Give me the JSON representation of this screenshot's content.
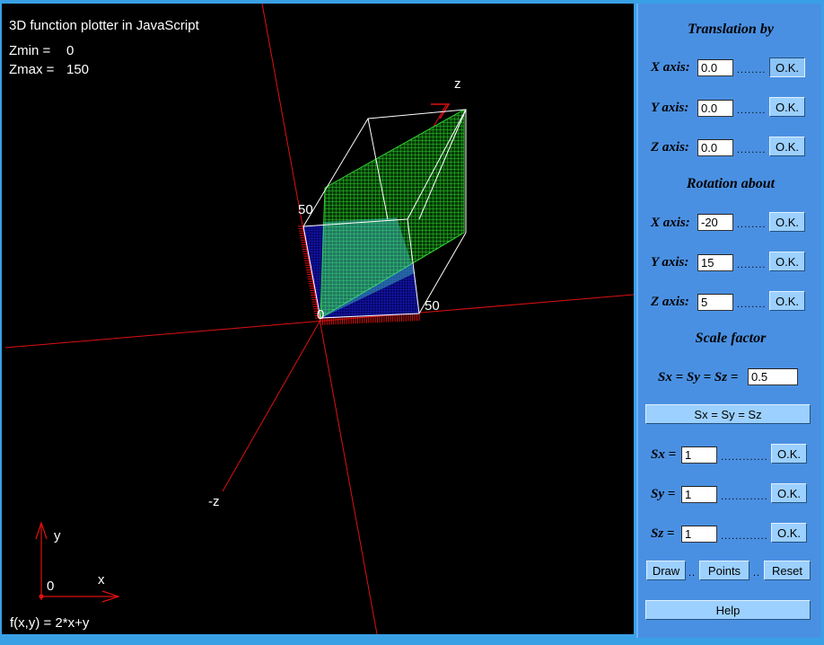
{
  "plot": {
    "title": "3D function plotter in JavaScript",
    "zmin_label": "Zmin =",
    "zmin_value": "0",
    "zmax_label": "Zmax =",
    "zmax_value": "150",
    "function_label": "f(x,y) = 2*x+y",
    "axis_z_label": "z",
    "axis_negz_label": "-z",
    "tick_50_left": "50",
    "tick_0": "0",
    "tick_50_right": "50",
    "legend_y": "y",
    "legend_x": "x",
    "legend_origin": "0",
    "colors": {
      "background": "#000000",
      "axes": "#e01010",
      "surface": "#33dd33",
      "base": "#1010b0",
      "box": "#ffffff"
    }
  },
  "panel": {
    "translation": {
      "title": "Translation by",
      "x": {
        "label": "X axis:",
        "value": "0.0",
        "button": "O.K."
      },
      "y": {
        "label": "Y axis:",
        "value": "0.0",
        "button": "O.K."
      },
      "z": {
        "label": "Z axis:",
        "value": "0.0",
        "button": "O.K."
      }
    },
    "rotation": {
      "title": "Rotation about",
      "x": {
        "label": "X axis:",
        "value": "-20",
        "button": "O.K."
      },
      "y": {
        "label": "Y axis:",
        "value": "15",
        "button": "O.K."
      },
      "z": {
        "label": "Z axis:",
        "value": "5",
        "button": "O.K."
      }
    },
    "scale": {
      "title": "Scale factor",
      "uniform_label": "Sx = Sy = Sz =",
      "uniform_value": "0.5",
      "uniform_button": "Sx = Sy = Sz",
      "sx": {
        "label": "Sx =",
        "value": "1",
        "button": "O.K."
      },
      "sy": {
        "label": "Sy =",
        "value": "1",
        "button": "O.K."
      },
      "sz": {
        "label": "Sz =",
        "value": "1",
        "button": "O.K."
      }
    },
    "actions": {
      "draw": "Draw",
      "points": "Points",
      "reset": "Reset",
      "help": "Help"
    },
    "accent": "#4a90e2"
  }
}
